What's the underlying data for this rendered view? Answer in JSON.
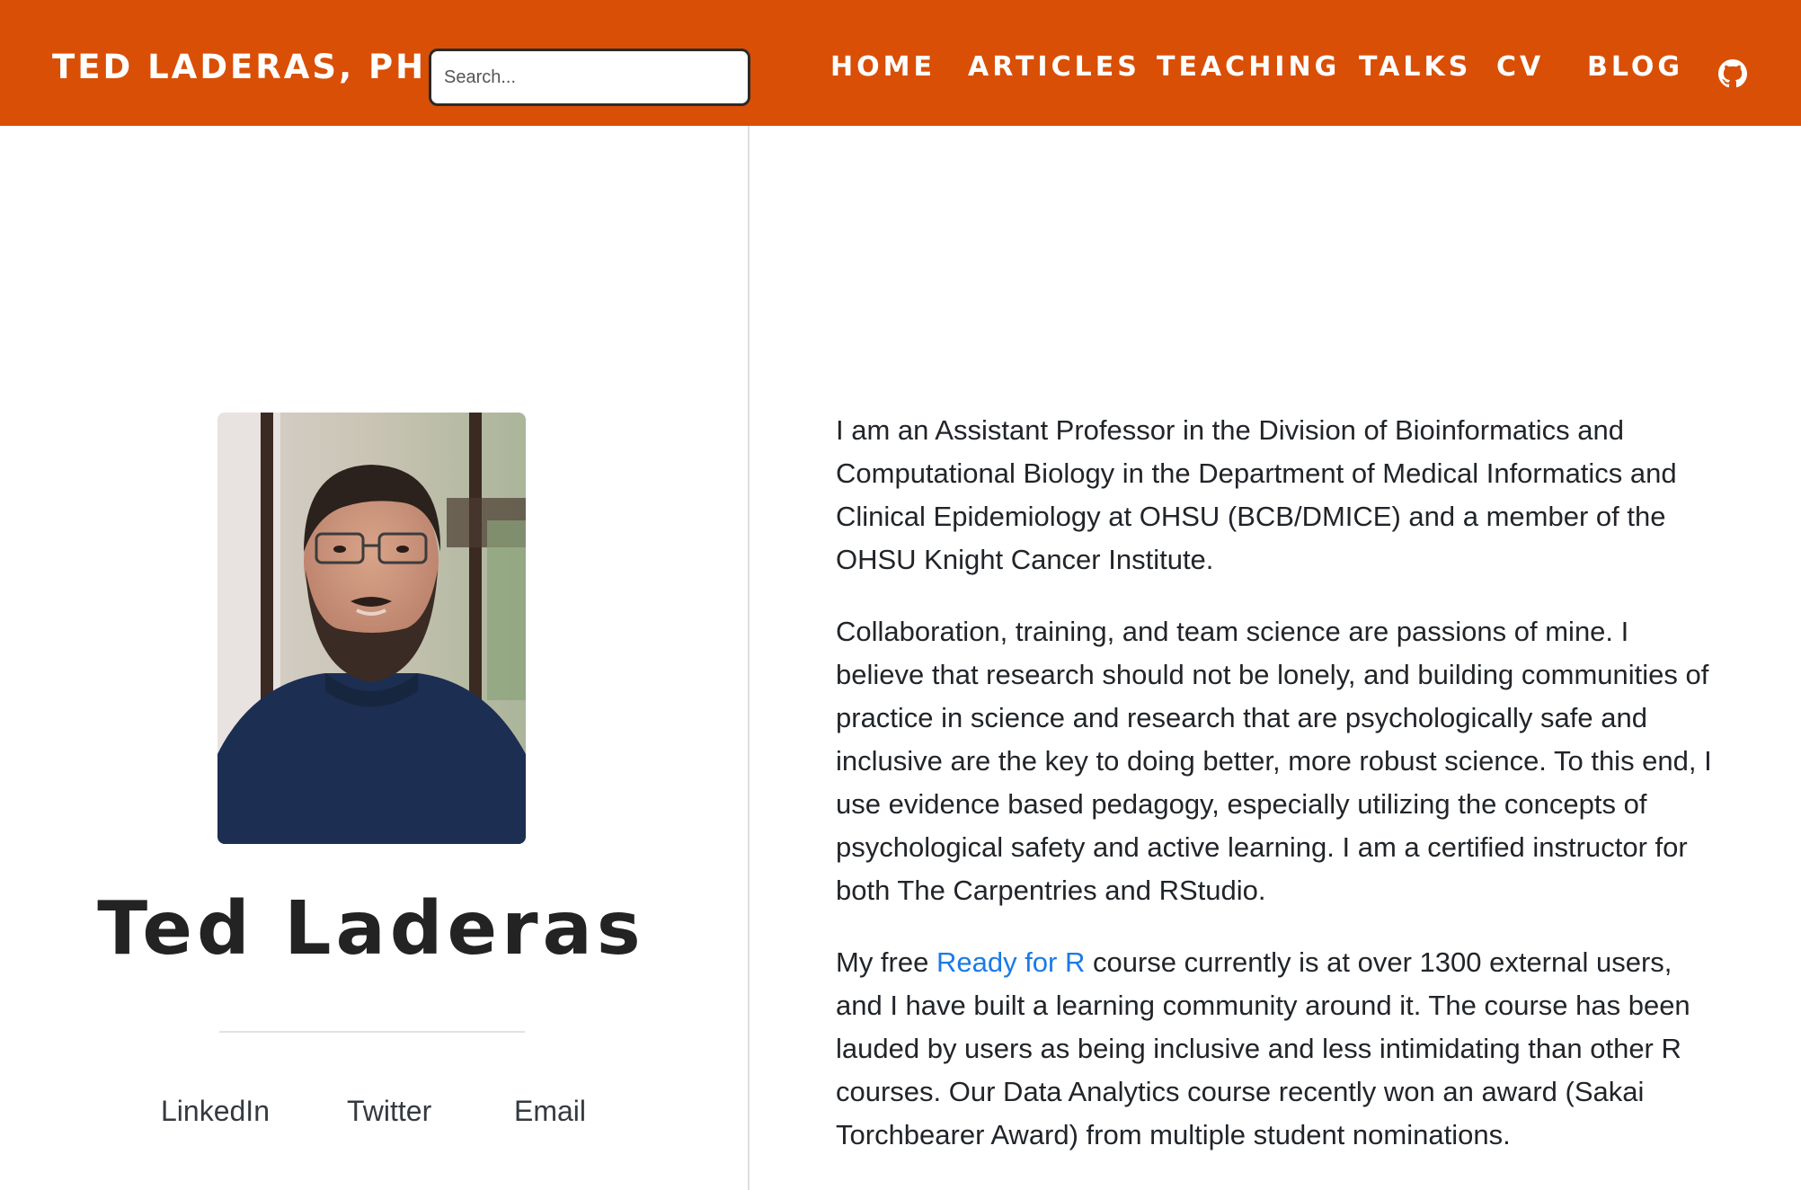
{
  "navbar": {
    "brand": "TED LADERAS, PHD",
    "search_placeholder": "Search...",
    "links": [
      {
        "label": "HOME"
      },
      {
        "label": "ARTICLES"
      },
      {
        "label": "TEACHING"
      },
      {
        "label": "TALKS"
      },
      {
        "label": "CV"
      },
      {
        "label": "BLOG"
      }
    ],
    "github_icon": "github-icon",
    "background_color": "#d94f05"
  },
  "profile": {
    "name": "Ted Laderas",
    "photo_icon": "profile-photo",
    "social": [
      {
        "label": "LinkedIn"
      },
      {
        "label": "Twitter"
      },
      {
        "label": "Email"
      }
    ]
  },
  "bio": {
    "paragraph_1": "I am an Assistant Professor in the Division of Bioinformatics and Computational Biology in the Department of Medical Informatics and Clinical Epidemiology at OHSU (BCB/DMICE) and a member of the OHSU Knight Cancer Institute.",
    "paragraph_2": "Collaboration, training, and team science are passions of mine. I believe that research should not be lonely, and building communities of practice in science and research that are psychologically safe and inclusive are the key to doing better, more robust science. To this end, I use evidence based pedagogy, especially utilizing the concepts of psychological safety and active learning. I am a certified instructor for both The Carpentries and RStudio.",
    "paragraph_3_before": "My free ",
    "paragraph_3_link": "Ready for R",
    "paragraph_3_after": " course currently is at over 1300 external users, and I have built a learning community around it. The course has been lauded by users as being inclusive and less intimidating than other R courses. Our Data Analytics course recently won an award (Sakai Torchbearer Award) from multiple student nominations.",
    "link_color": "#1a7ae6"
  }
}
